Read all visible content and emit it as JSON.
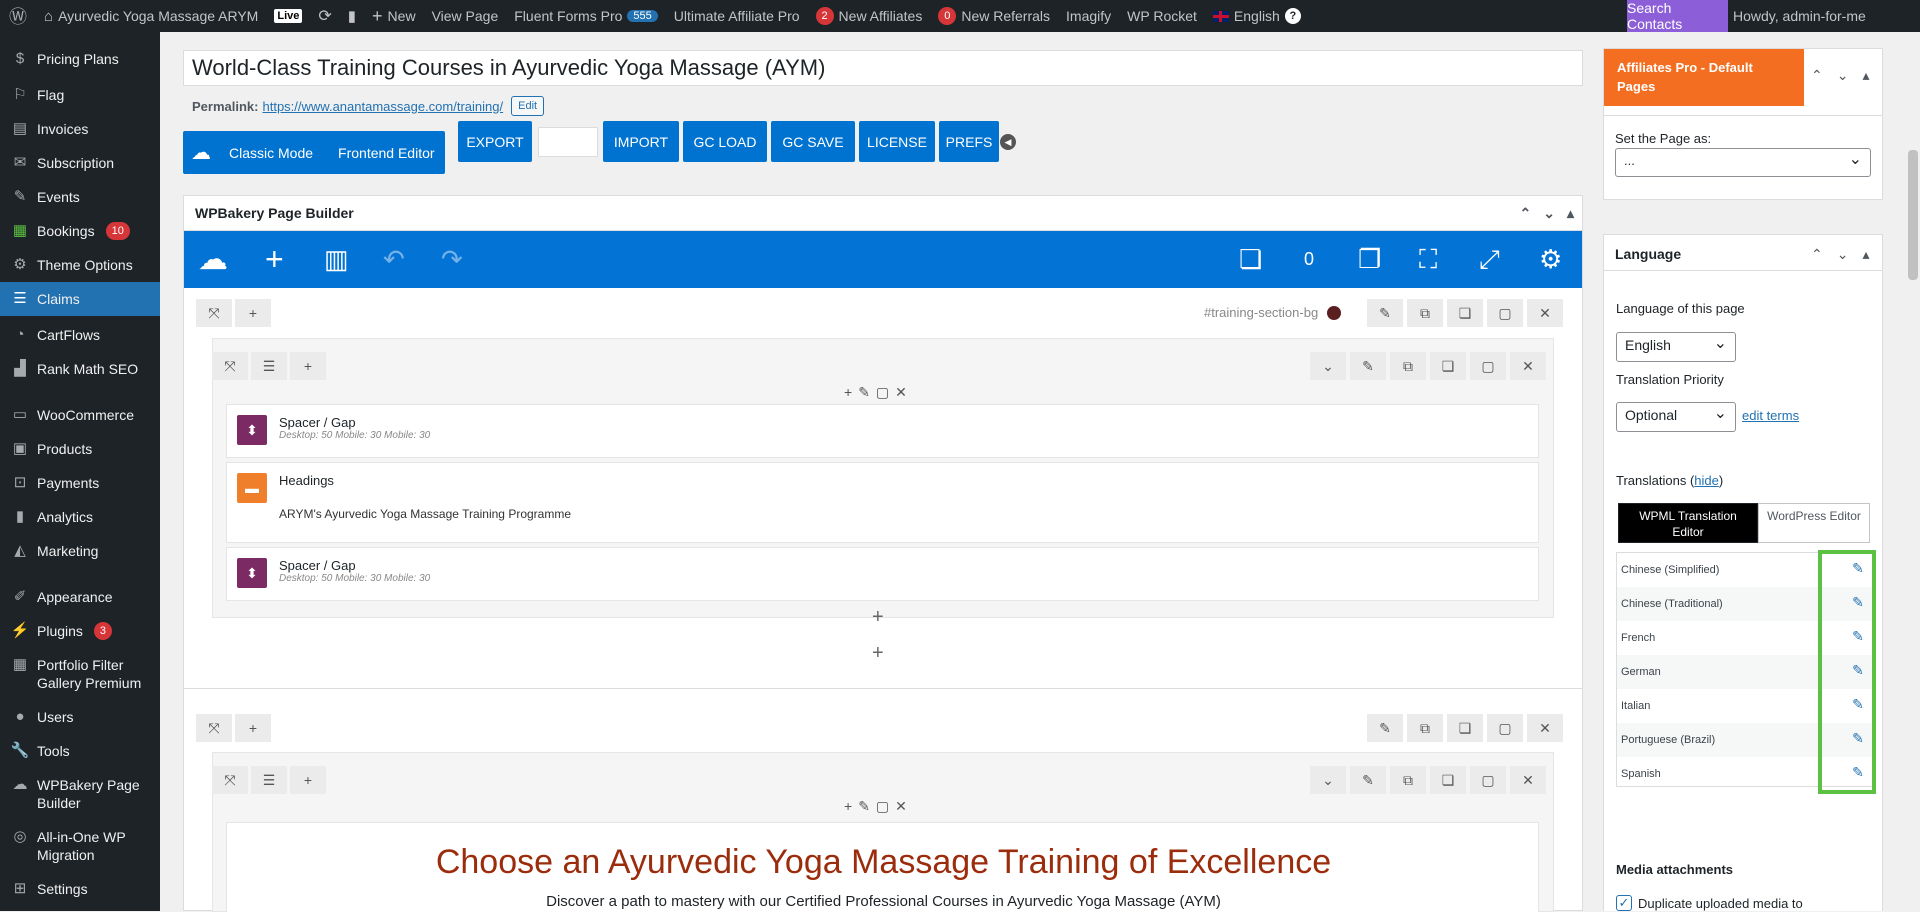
{
  "admin_bar": {
    "site_name": "Ayurvedic Yoga Massage ARYM",
    "live": "Live",
    "new": "New",
    "view_page": "View Page",
    "fluent_forms": "Fluent Forms Pro",
    "fluent_count": "555",
    "ultimate_affiliate": "Ultimate Affiliate Pro",
    "aff_badge": "2",
    "new_affiliates": "New Affiliates",
    "ref_badge": "0",
    "new_referrals": "New Referrals",
    "imagify": "Imagify",
    "wp_rocket": "WP Rocket",
    "language": "English",
    "help": "?",
    "search_contacts": "Search Contacts",
    "howdy": "Howdy, admin-for-me"
  },
  "sidebar": {
    "items": [
      {
        "label": "Pricing Plans",
        "icon": "dollar-icon"
      },
      {
        "label": "Flag",
        "icon": "flag-icon"
      },
      {
        "label": "Invoices",
        "icon": "invoice-icon"
      },
      {
        "label": "Subscription",
        "icon": "mail-icon"
      },
      {
        "label": "Events",
        "icon": "pin-icon"
      },
      {
        "label": "Bookings",
        "icon": "calendar-icon",
        "badge": "10"
      },
      {
        "label": "Theme Options",
        "icon": "gear-icon"
      },
      {
        "label": "Claims",
        "icon": "list-icon",
        "active": true
      },
      {
        "label": "CartFlows",
        "icon": "flow-icon"
      },
      {
        "label": "Rank Math SEO",
        "icon": "chart-icon"
      },
      {
        "label": "WooCommerce",
        "icon": "woo-icon"
      },
      {
        "label": "Products",
        "icon": "box-icon"
      },
      {
        "label": "Payments",
        "icon": "dollar-box-icon"
      },
      {
        "label": "Analytics",
        "icon": "bar-chart-icon"
      },
      {
        "label": "Marketing",
        "icon": "megaphone-icon"
      },
      {
        "label": "Appearance",
        "icon": "brush-icon"
      },
      {
        "label": "Plugins",
        "icon": "plug-icon",
        "badge": "3"
      },
      {
        "label": "Portfolio Filter Gallery Premium",
        "icon": "grid-icon"
      },
      {
        "label": "Users",
        "icon": "user-icon"
      },
      {
        "label": "Tools",
        "icon": "wrench-icon"
      },
      {
        "label": "WPBakery Page Builder",
        "icon": "cloud-icon"
      },
      {
        "label": "All-in-One WP Migration",
        "icon": "migration-icon"
      },
      {
        "label": "Settings",
        "icon": "settings-icon"
      }
    ]
  },
  "editor": {
    "title": "World-Class Training Courses in Ayurvedic Yoga Massage (AYM)",
    "permalink_label": "Permalink:",
    "permalink_url": "https://www.anantamassage.com/training/",
    "edit": "Edit"
  },
  "toolbar": {
    "classic_mode": "Classic Mode",
    "frontend_editor": "Frontend Editor",
    "export": "EXPORT",
    "import": "IMPORT",
    "gc_load": "GC LOAD",
    "gc_save": "GC SAVE",
    "license": "LICENSE",
    "prefs": "PREFS"
  },
  "wpbakery": {
    "title": "WPBakery Page Builder",
    "count": "0",
    "section_id": "#training-section-bg",
    "elements": [
      {
        "title": "Spacer / Gap",
        "sub": "Desktop: 50   Mobile: 30   Mobile: 30"
      },
      {
        "title": "Headings",
        "text": "ARYM's Ayurvedic Yoga Massage Training Programme"
      },
      {
        "title": "Spacer / Gap",
        "sub": "Desktop: 50   Mobile: 30   Mobile: 30"
      }
    ],
    "heading2": "Choose an Ayurvedic Yoga Massage Training of Excellence",
    "sub2": "Discover a path to mastery with our Certified Professional Courses in Ayurvedic Yoga Massage (AYM)"
  },
  "affiliates": {
    "title": "Affiliates Pro - Default Pages",
    "set_page": "Set the Page as:",
    "selected": "..."
  },
  "language": {
    "title": "Language",
    "lang_of_page": "Language of this page",
    "lang_value": "English",
    "priority_label": "Translation Priority",
    "priority_value": "Optional",
    "edit_terms": "edit terms",
    "translations": "Translations",
    "hide": "hide",
    "tab_wpml": "WPML Translation Editor",
    "tab_wp": "WordPress Editor",
    "languages": [
      "Chinese (Simplified)",
      "Chinese (Traditional)",
      "French",
      "German",
      "Italian",
      "Portuguese (Brazil)",
      "Spanish"
    ],
    "media_attachments": "Media attachments",
    "duplicate_media": "Duplicate uploaded media to"
  },
  "colors": {
    "wp_blue": "#2271b1",
    "wpb_blue": "#0473d6",
    "affiliate_orange": "#f36e21",
    "highlight_green": "#5cc142",
    "heading_red": "#9b2c0c"
  }
}
